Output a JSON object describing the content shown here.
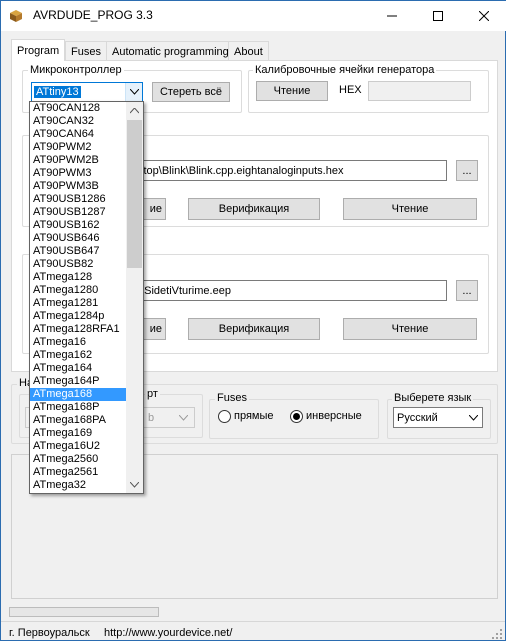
{
  "window": {
    "title": "AVRDUDE_PROG 3.3"
  },
  "tabs": [
    "Program",
    "Fuses",
    "Automatic programming",
    "About"
  ],
  "mcu": {
    "legend": "Микроконтроллер",
    "selected": "ATtiny13",
    "erase_label": "Стереть всё",
    "options": [
      "AT90CAN128",
      "AT90CAN32",
      "AT90CAN64",
      "AT90PWM2",
      "AT90PWM2B",
      "AT90PWM3",
      "AT90PWM3B",
      "AT90USB1286",
      "AT90USB1287",
      "AT90USB162",
      "AT90USB646",
      "AT90USB647",
      "AT90USB82",
      "ATmega128",
      "ATmega1280",
      "ATmega1281",
      "ATmega1284p",
      "ATmega128RFA1",
      "ATmega16",
      "ATmega162",
      "ATmega164",
      "ATmega164P",
      "ATmega168",
      "ATmega168P",
      "ATmega168PA",
      "ATmega169",
      "ATmega16U2",
      "ATmega2560",
      "ATmega2561",
      "ATmega32"
    ],
    "highlighted": "ATmega168"
  },
  "calibration": {
    "legend": "Калибровочные ячейки генератора",
    "read_label": "Чтение",
    "hex_label": "HEX",
    "hex_value": ""
  },
  "flash": {
    "path": "ktop\\Blink\\Blink.cpp.eightanaloginputs.hex",
    "browse": "...",
    "write_partial": "ие",
    "verify": "Верификация",
    "read": "Чтение"
  },
  "eeprom": {
    "path": "hSidetiVturime.eep",
    "browse": "...",
    "write_partial": "ие",
    "verify": "Верификация",
    "read": "Чтение"
  },
  "bottom": {
    "settings_partial": "На",
    "port_partial": "рт",
    "port_partial_value": "b",
    "fuses_legend": "Fuses",
    "fuses_direct": "прямые",
    "fuses_inverse": "инверсные",
    "lang_legend": "Выберете язык",
    "lang_value": "Русский"
  },
  "status": {
    "city": "г. Первоуральск",
    "url": "http://www.yourdevice.net/"
  },
  "progress": 0
}
